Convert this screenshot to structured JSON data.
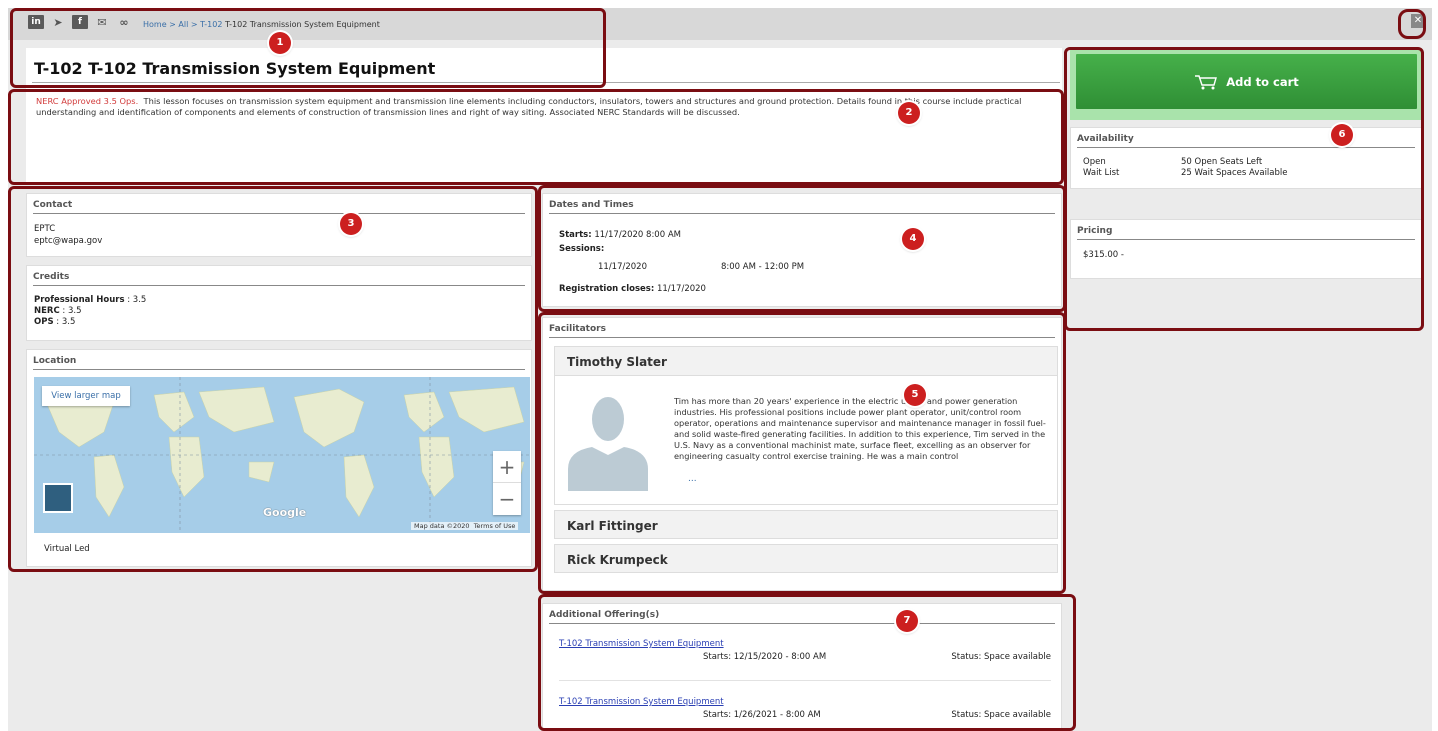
{
  "topbar": {
    "social_icons": [
      "linkedin-icon",
      "twitter-icon",
      "facebook-icon",
      "email-icon",
      "link-icon"
    ],
    "social_glyphs": [
      "in",
      "➤",
      "f",
      "✉",
      "∞"
    ],
    "breadcrumb": {
      "home": "Home",
      "sep1": " > ",
      "all": "All",
      "sep2": " > ",
      "code": "T-102",
      "current": "T-102 Transmission System Equipment"
    },
    "close_glyph": "✕"
  },
  "course": {
    "title": "T-102  T-102 Transmission System Equipment",
    "nerc_note": "NERC Approved 3.5 Ops.",
    "description": "This lesson focuses on transmission system equipment and transmission line elements including conductors, insulators, towers and structures and ground protection. Details found in this course include practical understanding and identification of components and elements of construction of transmission lines and right of way siting. Associated NERC Standards will be discussed."
  },
  "contact": {
    "heading": "Contact",
    "name": "EPTC",
    "email": "eptc@wapa.gov"
  },
  "credits": {
    "heading": "Credits",
    "items": [
      {
        "label": "Professional Hours",
        "sep": " : ",
        "value": "3.5"
      },
      {
        "label": "NERC",
        "sep": " : ",
        "value": "3.5"
      },
      {
        "label": "OPS",
        "sep": " : ",
        "value": "3.5"
      }
    ]
  },
  "location": {
    "heading": "Location",
    "map_button": "View larger map",
    "zoom_in": "+",
    "zoom_out": "−",
    "brand": "Google",
    "map_data": "Map data ©2020",
    "terms": "Terms of Use",
    "place": "Virtual Led"
  },
  "dates": {
    "heading": "Dates and Times",
    "starts_label": "Starts:",
    "starts_value": "11/17/2020  8:00 AM",
    "sessions_label": "Sessions:",
    "session_date": "11/17/2020",
    "session_time": "8:00 AM - 12:00 PM",
    "closes_label": "Registration closes:",
    "closes_value": "11/17/2020"
  },
  "facilitators": {
    "heading": "Facilitators",
    "people": [
      {
        "name": "Timothy  Slater",
        "bio": "Tim has more than 20 years' experience in the electric utility and power generation industries. His professional positions include power plant operator, unit/control room operator, operations and maintenance supervisor and maintenance manager in fossil fuel- and solid waste-fired generating facilities. In addition to this experience, Tim served in the U.S. Navy as a conventional machinist mate, surface fleet, excelling as an observer for engineering casualty control exercise training. He was a main control",
        "more": "..."
      },
      {
        "name": "Karl  Fittinger"
      },
      {
        "name": "Rick  Krumpeck"
      }
    ]
  },
  "offerings": {
    "heading": "Additional Offering(s)",
    "items": [
      {
        "title": "T-102 Transmission System Equipment",
        "starts": "Starts: 12/15/2020 - 8:00 AM",
        "status": "Status: Space available"
      },
      {
        "title": "T-102 Transmission System Equipment",
        "starts": "Starts: 1/26/2021 - 8:00 AM",
        "status": "Status: Space available"
      }
    ]
  },
  "cart": {
    "label": "Add to cart",
    "icon": "cart-icon"
  },
  "availability": {
    "heading": "Availability",
    "rows": [
      {
        "label": "Open",
        "value": "50 Open Seats Left"
      },
      {
        "label": "Wait List",
        "value": "25 Wait Spaces Available"
      }
    ]
  },
  "pricing": {
    "heading": "Pricing",
    "value": "$315.00 -"
  },
  "callouts": [
    "1",
    "2",
    "3",
    "4",
    "5",
    "6",
    "7"
  ],
  "colors": {
    "callout": "#cc1f1f",
    "frame": "#7a0d12",
    "cta": "#3aa53f",
    "nerc": "#d23c3c"
  }
}
